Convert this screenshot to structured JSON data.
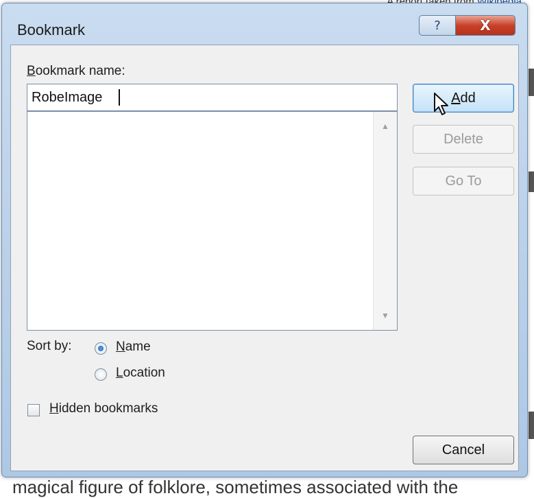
{
  "background": {
    "top_text": "A report taken from ",
    "top_link": "Wikipedia",
    "bottom_text": "magical figure of folklore, sometimes associated with the"
  },
  "dialog": {
    "title": "Bookmark",
    "help_icon": "?",
    "close_icon": "X"
  },
  "form": {
    "name_label_accel": "B",
    "name_label_rest": "ookmark name:",
    "name_value": "RobeImage",
    "bookmark_list": [],
    "sort_label": "Sort by:",
    "sort_options": [
      {
        "accel": "N",
        "rest": "ame",
        "checked": true
      },
      {
        "accel": "L",
        "rest": "ocation",
        "checked": false
      }
    ],
    "hidden_accel": "H",
    "hidden_rest": "idden bookmarks",
    "hidden_checked": false
  },
  "buttons": {
    "add_accel": "A",
    "add_rest": "dd",
    "delete": "Delete",
    "goto": "Go To",
    "cancel": "Cancel"
  },
  "icons": {
    "help": "help-icon",
    "close": "close-icon",
    "cursor": "mouse-pointer-icon",
    "scroll_up": "scroll-up-icon",
    "scroll_down": "scroll-down-icon"
  },
  "colors": {
    "close_button": "#c9412a",
    "default_button_border": "#3b7cc0",
    "radio_dot": "#1d5ea8"
  }
}
